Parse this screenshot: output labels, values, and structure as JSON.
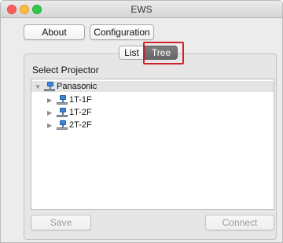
{
  "window": {
    "title": "EWS"
  },
  "toolbar": {
    "about_label": "About",
    "configuration_label": "Configuration"
  },
  "view_toggle": {
    "list_label": "List",
    "tree_label": "Tree",
    "selected": "Tree"
  },
  "panel": {
    "label": "Select Projector",
    "tree": {
      "root": {
        "label": "Panasonic",
        "expanded": true
      },
      "children": [
        {
          "label": "1T-1F"
        },
        {
          "label": "1T-2F"
        },
        {
          "label": "2T-2F"
        }
      ]
    }
  },
  "footer": {
    "save_label": "Save",
    "connect_label": "Connect"
  },
  "colors": {
    "highlight": "#d0232f",
    "selected_segment": "#6f6f6f"
  },
  "icons": {
    "tree_node": "network-projector-icon",
    "disclosure_closed": "triangle-right-icon",
    "disclosure_open": "triangle-down-icon"
  }
}
